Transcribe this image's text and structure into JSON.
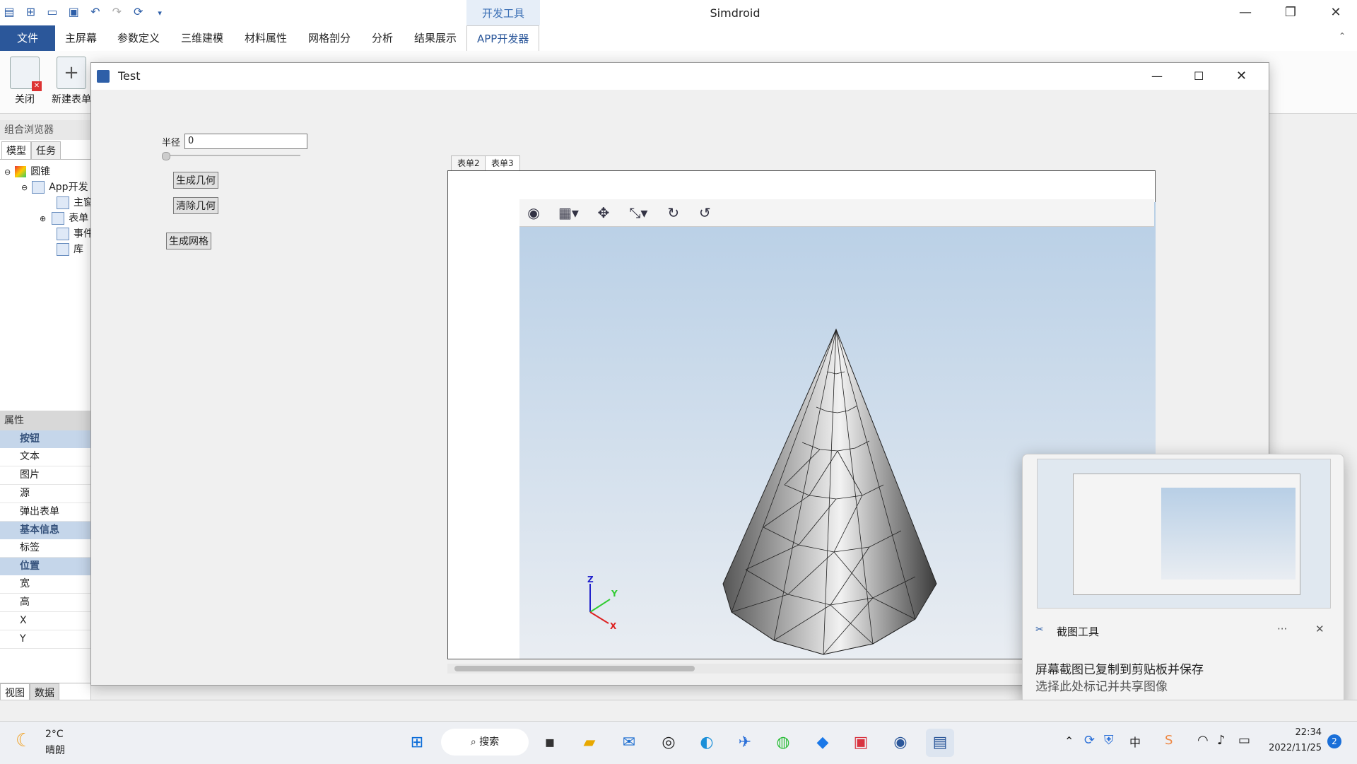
{
  "app": {
    "title": "Simdroid",
    "contextual_tab": "开发工具"
  },
  "ribbon_tabs": [
    "文件",
    "主屏幕",
    "参数定义",
    "三维建模",
    "材料属性",
    "网格剖分",
    "分析",
    "结果展示",
    "APP开发器"
  ],
  "ribbon": {
    "close_label": "关闭",
    "new_form_label": "新建表单"
  },
  "left_panel": {
    "browser_title": "组合浏览器",
    "tabs": [
      "模型",
      "任务"
    ],
    "tree": {
      "root": "圆锥",
      "app": "App开发",
      "children": [
        "主窗",
        "表单",
        "事件",
        "库"
      ]
    },
    "properties_title": "属性",
    "properties": [
      {
        "type": "cat",
        "label": "按钮"
      },
      {
        "type": "row",
        "label": "文本"
      },
      {
        "type": "row",
        "label": "图片"
      },
      {
        "type": "row",
        "label": "源"
      },
      {
        "type": "row",
        "label": "弹出表单"
      },
      {
        "type": "cat",
        "label": "基本信息"
      },
      {
        "type": "row",
        "label": "标签"
      },
      {
        "type": "cat",
        "label": "位置"
      },
      {
        "type": "row",
        "label": "宽"
      },
      {
        "type": "row",
        "label": "高"
      },
      {
        "type": "row",
        "label": "X"
      },
      {
        "type": "row",
        "label": "Y"
      }
    ],
    "bottom_tabs": [
      "视图",
      "数据"
    ]
  },
  "dialog": {
    "title": "Test",
    "radius_label": "半径",
    "radius_value": "0",
    "generate_geometry": "生成几何",
    "clear_geometry": "清除几何",
    "generate_mesh": "生成网格",
    "view_tabs": [
      "表单2",
      "表单3"
    ],
    "axis": {
      "z": "Z",
      "y": "Y",
      "x": "X"
    }
  },
  "notification": {
    "app_name": "截图工具",
    "more": "···",
    "title": "屏幕截图已复制到剪贴板并保存",
    "subtitle": "选择此处标记并共享图像"
  },
  "taskbar": {
    "weather_temp": "2°C",
    "weather_desc": "晴朗",
    "search": "搜索",
    "time": "22:34",
    "date": "2022/11/25",
    "notification_count": "2"
  }
}
